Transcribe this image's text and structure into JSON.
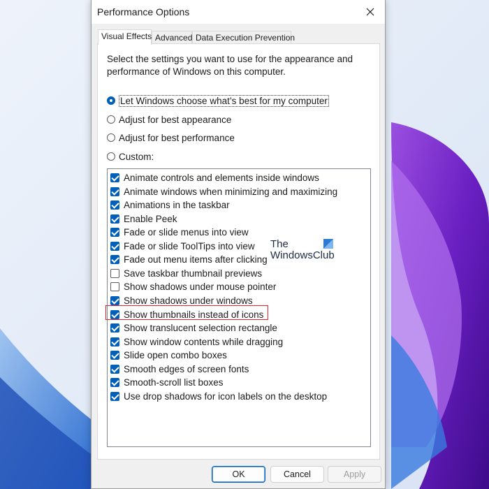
{
  "window": {
    "title": "Performance Options",
    "close_symbol": "✕"
  },
  "tabs": [
    {
      "label": "Visual Effects",
      "active": true
    },
    {
      "label": "Advanced",
      "active": false
    },
    {
      "label": "Data Execution Prevention",
      "active": false
    }
  ],
  "description": "Select the settings you want to use for the appearance and performance of Windows on this computer.",
  "radios": [
    {
      "label": "Let Windows choose what’s best for my computer",
      "checked": true
    },
    {
      "label": "Adjust for best appearance",
      "checked": false
    },
    {
      "label": "Adjust for best performance",
      "checked": false
    },
    {
      "label": "Custom:",
      "checked": false
    }
  ],
  "effects": [
    {
      "label": "Animate controls and elements inside windows",
      "checked": true
    },
    {
      "label": "Animate windows when minimizing and maximizing",
      "checked": true
    },
    {
      "label": "Animations in the taskbar",
      "checked": true
    },
    {
      "label": "Enable Peek",
      "checked": true
    },
    {
      "label": "Fade or slide menus into view",
      "checked": true
    },
    {
      "label": "Fade or slide ToolTips into view",
      "checked": true
    },
    {
      "label": "Fade out menu items after clicking",
      "checked": true
    },
    {
      "label": "Save taskbar thumbnail previews",
      "checked": false
    },
    {
      "label": "Show shadows under mouse pointer",
      "checked": false
    },
    {
      "label": "Show shadows under windows",
      "checked": true
    },
    {
      "label": "Show thumbnails instead of icons",
      "checked": true
    },
    {
      "label": "Show translucent selection rectangle",
      "checked": true
    },
    {
      "label": "Show window contents while dragging",
      "checked": true
    },
    {
      "label": "Slide open combo boxes",
      "checked": true
    },
    {
      "label": "Smooth edges of screen fonts",
      "checked": true
    },
    {
      "label": "Smooth-scroll list boxes",
      "checked": true
    },
    {
      "label": "Use drop shadows for icon labels on the desktop",
      "checked": true
    }
  ],
  "highlighted_effect": "Show thumbnails instead of icons",
  "buttons": {
    "ok": "OK",
    "cancel": "Cancel",
    "apply": "Apply"
  },
  "watermark": {
    "line1": "The",
    "line2": "WindowsClub"
  },
  "colors": {
    "accent": "#005fb8",
    "highlight_border": "#e0242c"
  }
}
